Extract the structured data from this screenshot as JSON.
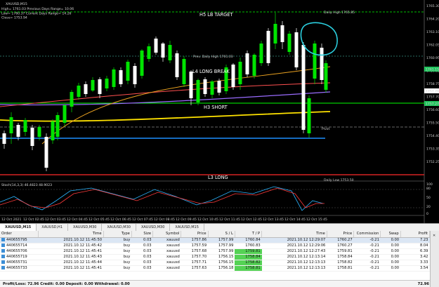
{
  "chart": {
    "symbol_line": "XAUUSD,M15",
    "info_lines": [
      "High= 1761.03   Previous Days Range= 10.06",
      "Low= 1760.37   Current Days Range= 14.26",
      "Close= 1753.94"
    ],
    "y_axis_labels": [
      "1765.30",
      "1764.20",
      "1763.10",
      "1762.05",
      "1760.95",
      "1759.85",
      "1758.75",
      "1757.70",
      "1756.60",
      "1755.50",
      "1754.40",
      "1753.35",
      "1752.25"
    ],
    "price_tags": [
      {
        "text": "1761.15",
        "color": "#22c55e"
      },
      {
        "text": "1757.76",
        "color": "#ffffff"
      },
      {
        "text": "1757.27",
        "color": "#22c55e"
      }
    ],
    "x_axis_labels": [
      "12 Oct 2021",
      "12 Oct 02:45",
      "12 Oct 03:45",
      "12 Oct 04:45",
      "12 Oct 05:45",
      "12 Oct 06:45",
      "12 Oct 07:45",
      "12 Oct 08:45",
      "12 Oct 09:45",
      "12 Oct 10:45",
      "12 Oct 11:45",
      "12 Oct 12:45",
      "12 Oct 13:45",
      "12 Oct 14:45",
      "12 Oct 15:45"
    ],
    "labels": {
      "h5": "H5 LB TARGET",
      "l4": "L4 LONG BREAK",
      "h3": "H3 SHORT",
      "l3": "L3 LONG",
      "prev_daily_high": "Prev. Daily High 1761.03",
      "pivot": "Pivot",
      "daily_high": "Daily High 1765.85",
      "daily_low": "Daily Low 1753.50"
    },
    "colors": {
      "green_line": "#00ff00",
      "blue_line": "#1e90ff",
      "red_line": "#ff2a2a",
      "yellow_line": "#ffe200",
      "orange_line": "#e8a020",
      "purple_line": "#9a6cff",
      "cyan_annotation": "#2bd0e0"
    },
    "osc_label": "Stoch(14,3,3) 46.4823 48.9023",
    "osc_axis": [
      "100",
      "80",
      "50",
      "20",
      "0"
    ]
  },
  "tabs": [
    "XAUUSD,M15",
    "XAUUSD,H1",
    "XAUUSD,M30",
    "XAUUSD,M30",
    "XAUUSD,M30",
    "XAUUSD,M15"
  ],
  "terminal": {
    "columns": [
      "Order",
      "Time",
      "Type",
      "Size",
      "Symbol",
      "Price",
      "S / L",
      "T / P",
      "Time",
      "Price",
      "Commission",
      "Swap",
      "Profit"
    ],
    "rows": [
      [
        "440655795",
        "2021.10.12 11:45:50",
        "buy",
        "0.03",
        "xauusd",
        "1757.86",
        "1757.99",
        "1760.84",
        "2021.10.12 12:29:07",
        "1760.27",
        "-0.21",
        "0.00",
        "7.23"
      ],
      [
        "440655714",
        "2021.10.12 11:45:42",
        "buy",
        "0.03",
        "xauusd",
        "1757.59",
        "1757.99",
        "1760.83",
        "2021.10.12 12:29:06",
        "1760.27",
        "-0.21",
        "0.00",
        "8.04"
      ],
      [
        "440655706",
        "2021.10.12 11:45:41",
        "buy",
        "0.03",
        "xauusd",
        "1757.68",
        "1757.99",
        "1759.81",
        "2021.10.12 12:27:43",
        "1759.81",
        "-0.21",
        "0.00",
        "6.39"
      ],
      [
        "440655719",
        "2021.10.12 11:45:43",
        "buy",
        "0.03",
        "xauusd",
        "1757.70",
        "1756.15",
        "1758.84",
        "2021.10.12 12:13:14",
        "1758.84",
        "-0.21",
        "0.00",
        "3.42"
      ],
      [
        "440655731",
        "2021.10.12 11:45:44",
        "buy",
        "0.03",
        "xauusd",
        "1757.71",
        "1756.15",
        "1758.82",
        "2021.10.12 12:13:13",
        "1758.82",
        "-0.21",
        "0.00",
        "3.33"
      ],
      [
        "440655733",
        "2021.10.12 11:45:41",
        "buy",
        "0.03",
        "xauusd",
        "1757.63",
        "1756.18",
        "1758.81",
        "2021.10.12 12:13:13",
        "1758.81",
        "-0.21",
        "0.00",
        "3.54"
      ]
    ],
    "summary_left": "Profit/Loss: 72.96  Credit: 0.00  Deposit: 0.00  Withdrawal: 0.00",
    "summary_right": "72.96"
  }
}
